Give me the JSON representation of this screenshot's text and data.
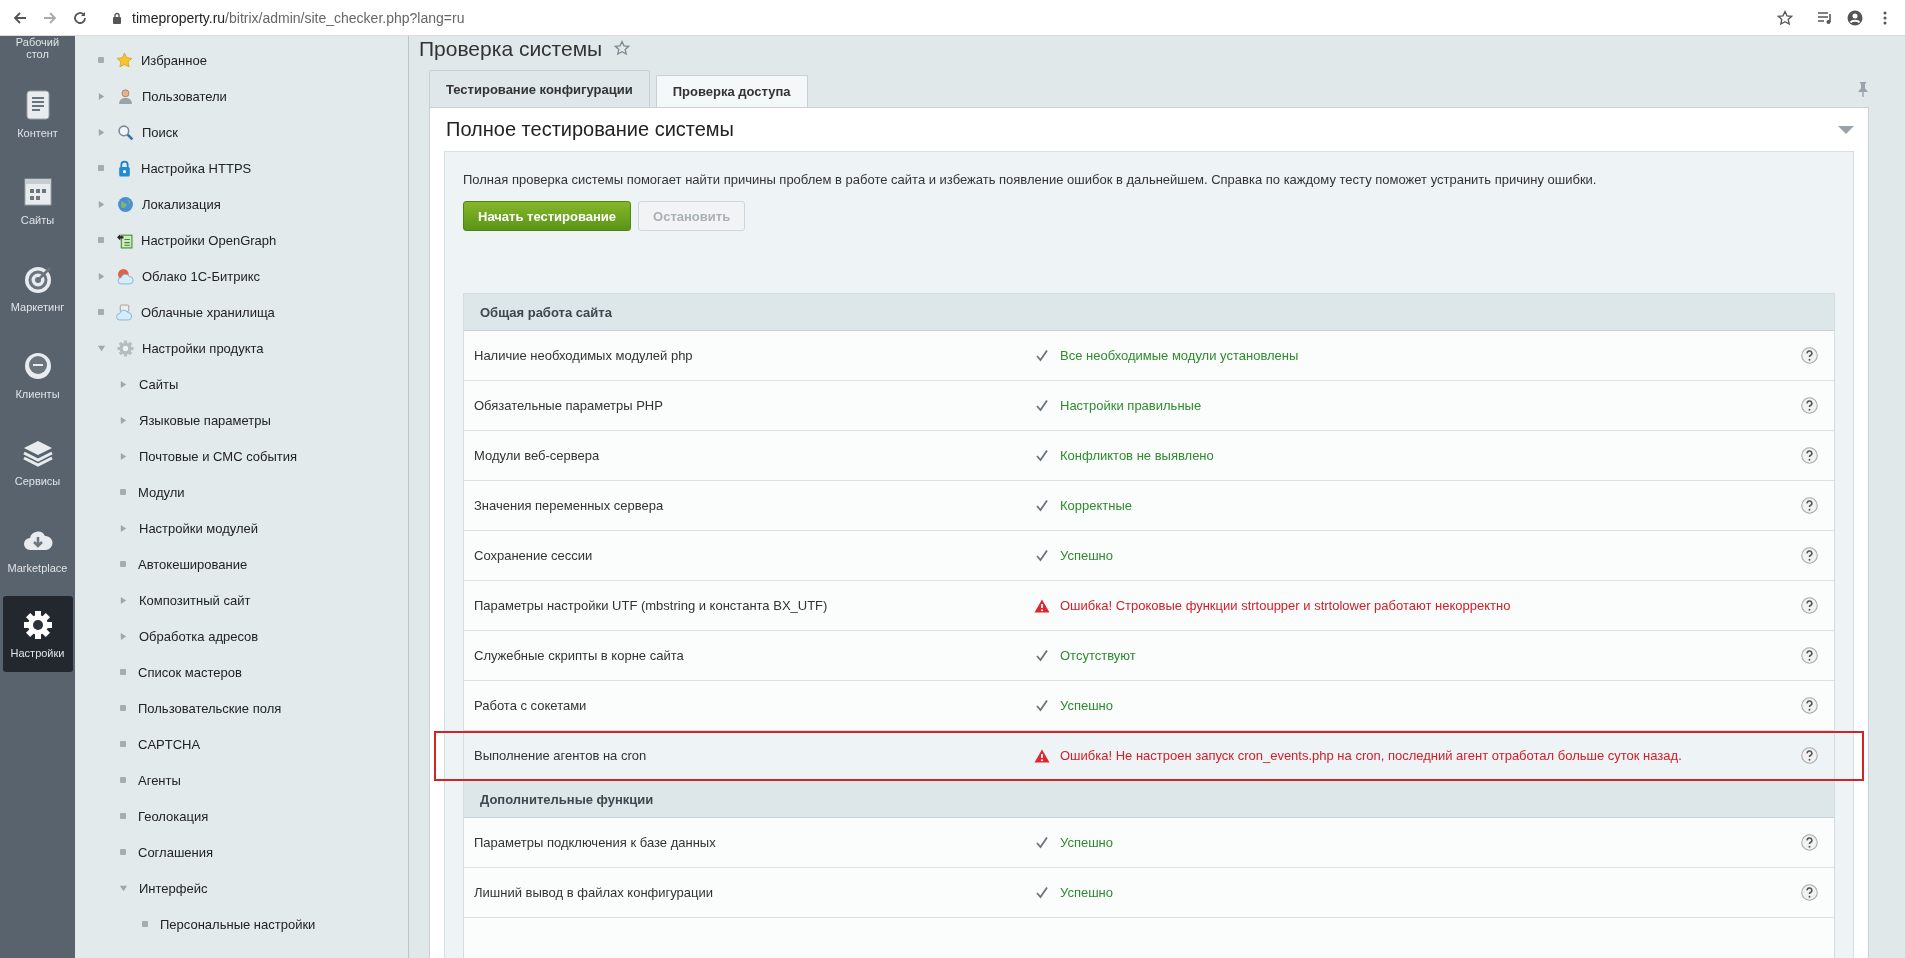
{
  "browser": {
    "url_host": "timeproperty.ru",
    "url_path": "/bitrix/admin/site_checker.php?lang=ru"
  },
  "sidebar": {
    "items": [
      {
        "label": "Рабочий стол",
        "selected": false
      },
      {
        "label": "Контент",
        "selected": false
      },
      {
        "label": "Сайты",
        "selected": false
      },
      {
        "label": "Маркетинг",
        "selected": false
      },
      {
        "label": "Клиенты",
        "selected": false
      },
      {
        "label": "Сервисы",
        "selected": false
      },
      {
        "label": "Marketplace",
        "selected": false
      },
      {
        "label": "Настройки",
        "selected": true
      }
    ]
  },
  "menu": {
    "items": [
      {
        "label": "Избранное",
        "kind": "leaf"
      },
      {
        "label": "Пользователи",
        "kind": "folder",
        "expanded": false
      },
      {
        "label": "Поиск",
        "kind": "folder",
        "expanded": false
      },
      {
        "label": "Настройка HTTPS",
        "kind": "leaf"
      },
      {
        "label": "Локализация",
        "kind": "folder",
        "expanded": false
      },
      {
        "label": "Настройки OpenGraph",
        "kind": "leaf"
      },
      {
        "label": "Облако 1С-Битрикс",
        "kind": "folder",
        "expanded": false
      },
      {
        "label": "Облачные хранилища",
        "kind": "leaf"
      },
      {
        "label": "Настройки продукта",
        "kind": "folder",
        "expanded": true,
        "children": [
          {
            "label": "Сайты",
            "kind": "folder",
            "expanded": false
          },
          {
            "label": "Языковые параметры",
            "kind": "folder",
            "expanded": false
          },
          {
            "label": "Почтовые и СМС события",
            "kind": "folder",
            "expanded": false
          },
          {
            "label": "Модули",
            "kind": "leaf"
          },
          {
            "label": "Настройки модулей",
            "kind": "folder",
            "expanded": false
          },
          {
            "label": "Автокеширование",
            "kind": "leaf"
          },
          {
            "label": "Композитный сайт",
            "kind": "folder",
            "expanded": false
          },
          {
            "label": "Обработка адресов",
            "kind": "folder",
            "expanded": false
          },
          {
            "label": "Список мастеров",
            "kind": "leaf"
          },
          {
            "label": "Пользовательские поля",
            "kind": "leaf"
          },
          {
            "label": "CAPTCHA",
            "kind": "leaf"
          },
          {
            "label": "Агенты",
            "kind": "leaf"
          },
          {
            "label": "Геолокация",
            "kind": "leaf"
          },
          {
            "label": "Соглашения",
            "kind": "leaf"
          },
          {
            "label": "Интерфейс",
            "kind": "folder",
            "expanded": true,
            "children": [
              {
                "label": "Персональные настройки",
                "kind": "leaf"
              }
            ]
          }
        ]
      }
    ]
  },
  "page": {
    "title": "Проверка системы",
    "tabs": [
      {
        "label": "Тестирование конфигурации",
        "selected": true
      },
      {
        "label": "Проверка доступа",
        "selected": false
      }
    ],
    "panel": {
      "title": "Полное тестирование системы",
      "expanded": true,
      "description": "Полная проверка системы помогает найти причины проблем в работе сайта и избежать появление ошибок в дальнейшем. Справка по каждому тесту поможет устранить причину ошибки.",
      "buttons": [
        {
          "label": "Начать тестирование",
          "disabled": false
        },
        {
          "label": "Остановить",
          "disabled": true
        }
      ],
      "sections": [
        {
          "title": "Общая работа сайта",
          "rows": [
            {
              "name": "Наличие необходимых модулей php",
              "kind": "ok",
              "result": "Все необходимые модули установлены",
              "highlighted": false
            },
            {
              "name": "Обязательные параметры PHP",
              "kind": "ok",
              "result": "Настройки правильные",
              "highlighted": false
            },
            {
              "name": "Модули веб-сервера",
              "kind": "ok",
              "result": "Конфликтов не выявлено",
              "highlighted": false
            },
            {
              "name": "Значения переменных сервера",
              "kind": "ok",
              "result": "Корректные",
              "highlighted": false
            },
            {
              "name": "Сохранение сессии",
              "kind": "ok",
              "result": "Успешно",
              "highlighted": false
            },
            {
              "name": "Параметры настройки UTF (mbstring и константа BX_UTF)",
              "kind": "error",
              "result": "Ошибка! Строковые функции strtoupper и strtolower работают некорректно",
              "highlighted": false
            },
            {
              "name": "Служебные скрипты в корне сайта",
              "kind": "ok",
              "result": "Отсутствуют",
              "highlighted": false
            },
            {
              "name": "Работа с сокетами",
              "kind": "ok",
              "result": "Успешно",
              "highlighted": false
            },
            {
              "name": "Выполнение агентов на cron",
              "kind": "error",
              "result": "Ошибка! Не настроен запуск cron_events.php на cron, последний агент отработал больше суток назад.",
              "highlighted": true
            }
          ]
        },
        {
          "title": "Дополнительные функции",
          "rows": [
            {
              "name": "Параметры подключения к базе данных",
              "kind": "ok",
              "result": "Успешно",
              "highlighted": false
            },
            {
              "name": "Лишний вывод в файлах конфигурации",
              "kind": "ok",
              "result": "Успешно",
              "highlighted": false
            }
          ]
        }
      ]
    }
  }
}
